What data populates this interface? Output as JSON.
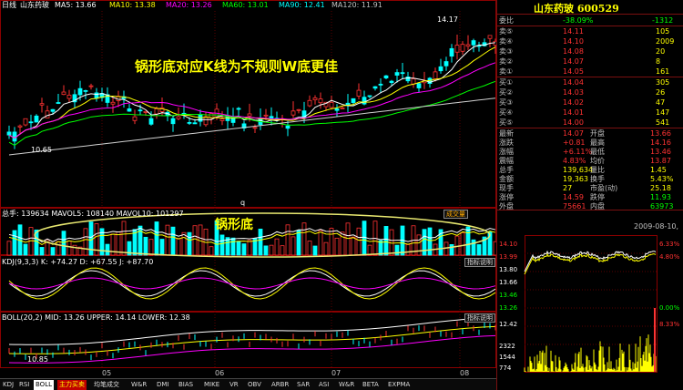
{
  "colors": {
    "up": "#ff3232",
    "down": "#00ffff",
    "ma5": "#ffffff",
    "ma10": "#ffff00",
    "ma20": "#ff00ff",
    "ma60": "#00ff00",
    "ma120": "#d0d0d0",
    "accent": "#ff0000",
    "title": "#ffff00"
  },
  "main": {
    "window_title": "日线",
    "stock_name": "山东药玻",
    "ma_legend": [
      {
        "text": "MA5: 13.66",
        "color": "#ffffff"
      },
      {
        "text": "MA10: 13.38",
        "color": "#ffff00"
      },
      {
        "text": "MA20: 13.26",
        "color": "#ff00ff"
      },
      {
        "text": "MA60: 13.01",
        "color": "#00ff00"
      },
      {
        "text": "MA90: 12.41",
        "color": "#00ffff"
      },
      {
        "text": "MA120: 11.91",
        "color": "#c0c0c0"
      }
    ],
    "annotation": "锅形底对应K线为不规则W底更佳",
    "high_label": "14.17",
    "low_label": "10.65",
    "cursor_mark": "q"
  },
  "volume": {
    "legend": "总手: 139634  MAVOL5: 108140  MAVOL10: 101297",
    "dropdown": "成交量",
    "annotation": "锅形底"
  },
  "kdj": {
    "legend": "KDJ(9,3,3)  K: +74.27  D: +67.55  J: +87.70",
    "button": "指标说明"
  },
  "boll": {
    "legend": "BOLL(20,2)  MID: 13.26  UPPER: 14.14  LOWER: 12.38",
    "button": "指标说明",
    "low_label": "10.85"
  },
  "xaxis": {
    "labels": [
      "05",
      "06",
      "07",
      "08"
    ]
  },
  "tabs": [
    "KDJ",
    "RSI",
    "BOLL",
    "主力买卖",
    "均笔成交",
    "W&R",
    "DMI",
    "BIAS",
    "MIKE",
    "VR",
    "OBV",
    "ARBR",
    "SAR",
    "ASI",
    "W&R",
    "BETA",
    "EXPMA"
  ],
  "quote": {
    "title": "山东药玻  600529",
    "weibi": {
      "label": "委比",
      "pct": "-38.09%",
      "diff": "-1312"
    },
    "sells": [
      {
        "label": "卖⑤",
        "price": "14.11",
        "vol": "105"
      },
      {
        "label": "卖④",
        "price": "14.10",
        "vol": "2009"
      },
      {
        "label": "卖③",
        "price": "14.08",
        "vol": "20"
      },
      {
        "label": "卖②",
        "price": "14.07",
        "vol": "8"
      },
      {
        "label": "卖①",
        "price": "14.05",
        "vol": "161"
      }
    ],
    "buys": [
      {
        "label": "买①",
        "price": "14.04",
        "vol": "305"
      },
      {
        "label": "买②",
        "price": "14.03",
        "vol": "26"
      },
      {
        "label": "买③",
        "price": "14.02",
        "vol": "47"
      },
      {
        "label": "买④",
        "price": "14.01",
        "vol": "147"
      },
      {
        "label": "买⑤",
        "price": "14.00",
        "vol": "541"
      }
    ],
    "stats": [
      {
        "l1": "最新",
        "v1": "14.07",
        "l2": "开盘",
        "v2": "13.66"
      },
      {
        "l1": "涨跌",
        "v1": "+0.81",
        "l2": "最高",
        "v2": "14.16"
      },
      {
        "l1": "涨幅",
        "v1": "+6.11%",
        "l2": "最低",
        "v2": "13.46"
      },
      {
        "l1": "震幅",
        "v1": "4.83%",
        "l2": "均价",
        "v2": "13.87"
      },
      {
        "l1": "总手",
        "v1": "139,634",
        "l2": "量比",
        "v2": "1.45"
      },
      {
        "l1": "金额",
        "v1": "19,363",
        "l2": "换手",
        "v2": "5.43%"
      },
      {
        "l1": "现手",
        "v1": "27",
        "l2": "市盈(动)",
        "v2": "25.18"
      },
      {
        "l1": "涨停",
        "v1": "14.59",
        "l2": "跌停",
        "v2": "11.93"
      },
      {
        "l1": "外盘",
        "v1": "75661",
        "l2": "内盘",
        "v2": "63973"
      }
    ],
    "intraday": {
      "date": "2009-08-10,",
      "price_labels": [
        "14.10",
        "13.99",
        "13.80",
        "13.66",
        "13.46",
        "13.26"
      ],
      "pct_labels": [
        "6.33%",
        "4.80%",
        "",
        "",
        "",
        "0.00%"
      ],
      "vol_labels": [
        "12.42",
        "8.33%",
        "2322",
        "1544",
        "774"
      ]
    }
  }
}
